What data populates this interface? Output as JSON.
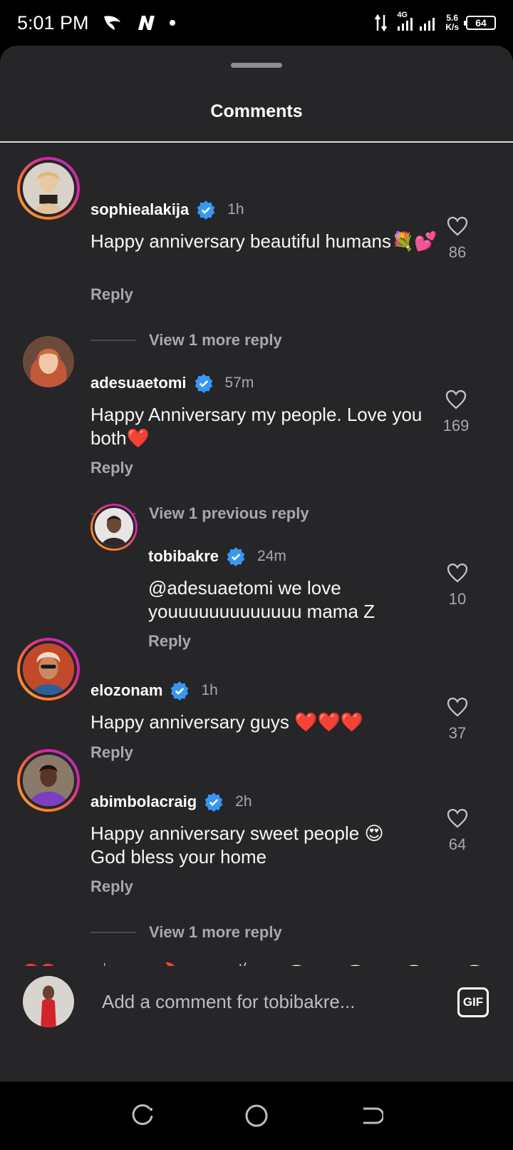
{
  "status_bar": {
    "time": "5:01 PM",
    "network": "4G",
    "speed_value": "5.6",
    "speed_unit": "K/s",
    "battery": "64"
  },
  "sheet": {
    "title": "Comments"
  },
  "comments": [
    {
      "username": "sophiealakija",
      "time": "1h",
      "text": "Happy anniversary beautiful humans💐💕",
      "reply_label": "Reply",
      "likes": "86",
      "thread_link": "View 1 more reply"
    },
    {
      "username": "adesuaetomi",
      "time": "57m",
      "text": "Happy Anniversary my people. Love you both❤️",
      "reply_label": "Reply",
      "likes": "169",
      "thread_link": "View 1 previous reply"
    },
    {
      "username": "tobibakre",
      "time": "24m",
      "text": "@adesuaetomi we love youuuuuuuuuuuuu mama Z",
      "reply_label": "Reply",
      "likes": "10"
    },
    {
      "username": "elozonam",
      "time": "1h",
      "text": "Happy anniversary guys ❤️❤️❤️",
      "reply_label": "Reply",
      "likes": "37"
    },
    {
      "username": "abimbolacraig",
      "time": "2h",
      "text": "Happy anniversary sweet people 😍 God bless your home",
      "reply_label": "Reply",
      "likes": "64",
      "thread_link": "View 1 more reply"
    }
  ],
  "quick_reactions": [
    "❤️",
    "🙌",
    "🔥",
    "👏",
    "😢",
    "😍",
    "😮",
    "😂"
  ],
  "composer": {
    "placeholder": "Add a comment for tobibakre...",
    "gif_label": "GIF"
  },
  "colors": {
    "sheet_bg": "#262528",
    "verified_blue": "#3897f0",
    "muted_text": "#a8a8ab"
  }
}
